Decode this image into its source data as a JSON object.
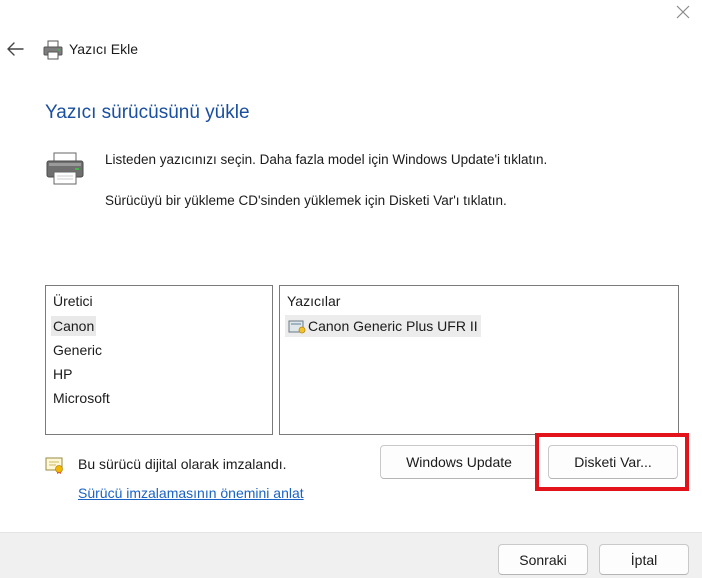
{
  "window": {
    "title": "Yazıcı Ekle"
  },
  "heading": "Yazıcı sürücüsünü yükle",
  "description": {
    "line1": "Listeden yazıcınızı seçin. Daha fazla model için Windows Update'i tıklatın.",
    "line2": "Sürücüyü bir yükleme CD'sinden yüklemek için Disketi Var'ı tıklatın."
  },
  "manufacturer_list": {
    "header": "Üretici",
    "items": [
      "Canon",
      "Generic",
      "HP",
      "Microsoft"
    ],
    "selected": "Canon"
  },
  "printer_list": {
    "header": "Yazıcılar",
    "items": [
      "Canon Generic Plus UFR II"
    ],
    "selected": "Canon Generic Plus UFR II"
  },
  "signature": {
    "status": "Bu sürücü dijital olarak imzalandı.",
    "link": "Sürücü imzalamasının önemini anlat"
  },
  "buttons": {
    "windows_update": "Windows Update",
    "have_disk": "Disketi Var...",
    "next": "Sonraki",
    "cancel": "İptal"
  },
  "colors": {
    "heading": "#1a4fa0",
    "link": "#1a63c4",
    "highlight": "#e3131b"
  }
}
